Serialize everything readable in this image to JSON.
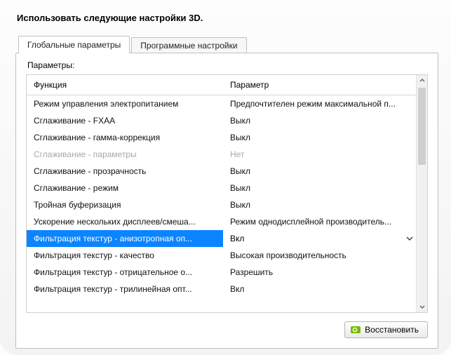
{
  "title": "Использовать следующие настройки 3D.",
  "tabs": {
    "global": "Глобальные параметры",
    "program": "Программные настройки"
  },
  "params_label": "Параметры:",
  "headers": {
    "function": "Функция",
    "parameter": "Параметр"
  },
  "rows": [
    {
      "fn": "Режим управления электропитанием",
      "val": "Предпочтителен режим максимальной п...",
      "disabled": false,
      "selected": false
    },
    {
      "fn": "Сглаживание - FXAA",
      "val": "Выкл",
      "disabled": false,
      "selected": false
    },
    {
      "fn": "Сглаживание - гамма-коррекция",
      "val": "Выкл",
      "disabled": false,
      "selected": false
    },
    {
      "fn": "Сглаживание - параметры",
      "val": "Нет",
      "disabled": true,
      "selected": false
    },
    {
      "fn": "Сглаживание - прозрачность",
      "val": "Выкл",
      "disabled": false,
      "selected": false
    },
    {
      "fn": "Сглаживание - режим",
      "val": "Выкл",
      "disabled": false,
      "selected": false
    },
    {
      "fn": "Тройная буферизация",
      "val": "Выкл",
      "disabled": false,
      "selected": false
    },
    {
      "fn": "Ускорение нескольких дисплеев/смеша...",
      "val": "Режим однодисплейной производитель...",
      "disabled": false,
      "selected": false
    },
    {
      "fn": "Фильтрация текстур - анизотропная оп...",
      "val": "Вкл",
      "disabled": false,
      "selected": true
    },
    {
      "fn": "Фильтрация текстур - качество",
      "val": "Высокая производительность",
      "disabled": false,
      "selected": false
    },
    {
      "fn": "Фильтрация текстур - отрицательное о...",
      "val": "Разрешить",
      "disabled": false,
      "selected": false
    },
    {
      "fn": "Фильтрация текстур - трилинейная опт...",
      "val": "Вкл",
      "disabled": false,
      "selected": false
    }
  ],
  "restore_label": "Восстановить"
}
